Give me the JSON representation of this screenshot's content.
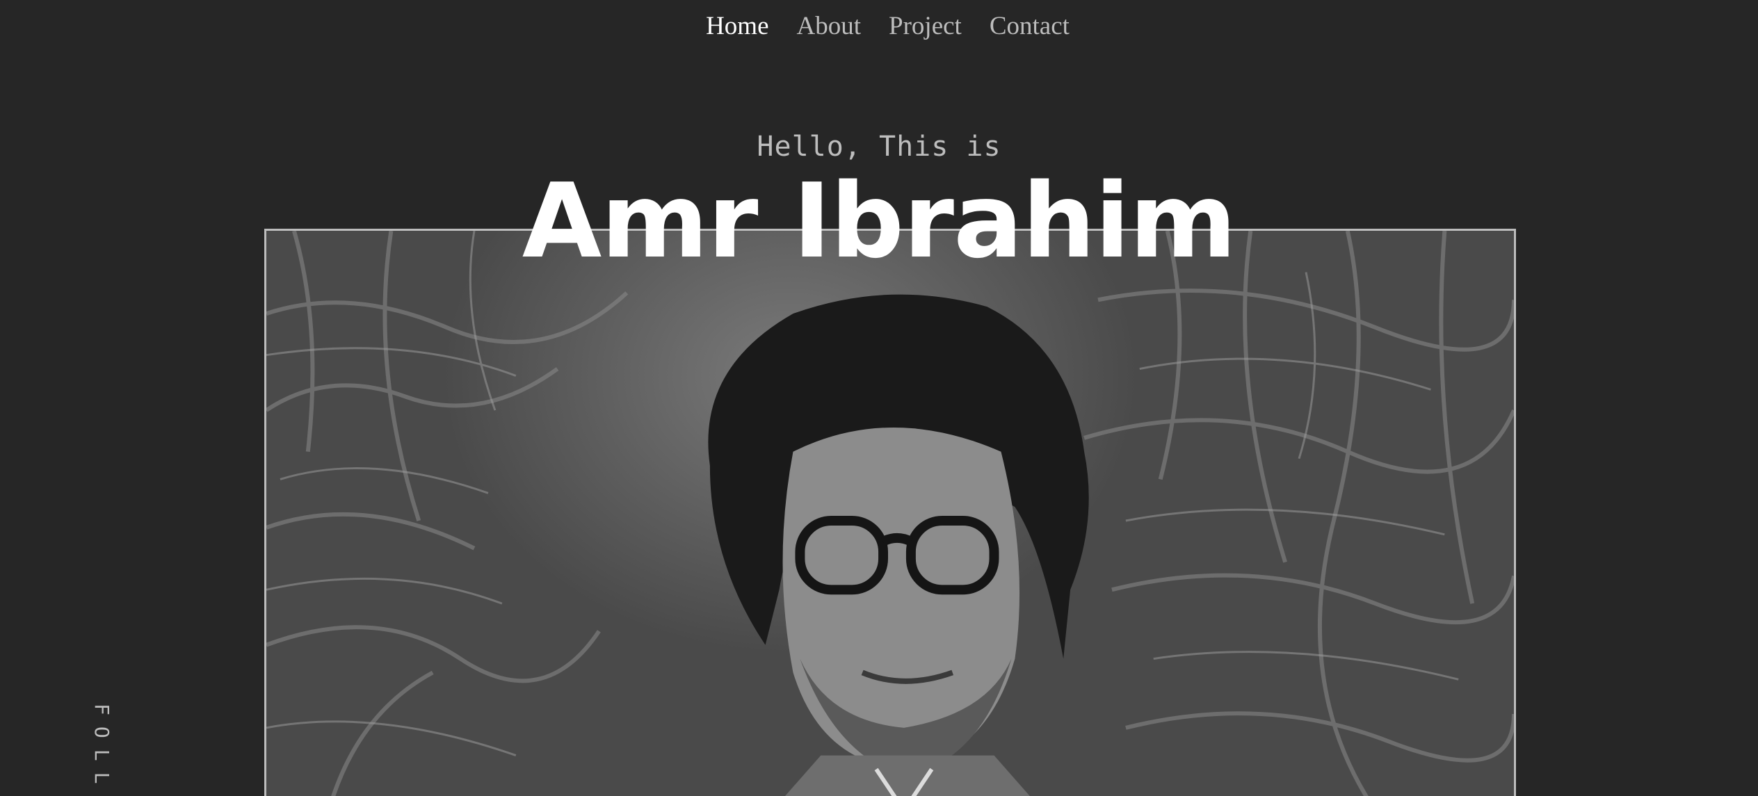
{
  "nav": {
    "items": [
      {
        "label": "Home",
        "active": true
      },
      {
        "label": "About",
        "active": false
      },
      {
        "label": "Project",
        "active": false
      },
      {
        "label": "Contact",
        "active": false
      }
    ]
  },
  "hero": {
    "greeting": "Hello, This is",
    "name": "Amr Ibrahim",
    "photo_subject": "portrait-photo"
  },
  "social": {
    "follow_label": "FOLL"
  },
  "colors": {
    "background": "#262626",
    "text_muted": "#bdbdbd",
    "text_active": "#ffffff"
  }
}
